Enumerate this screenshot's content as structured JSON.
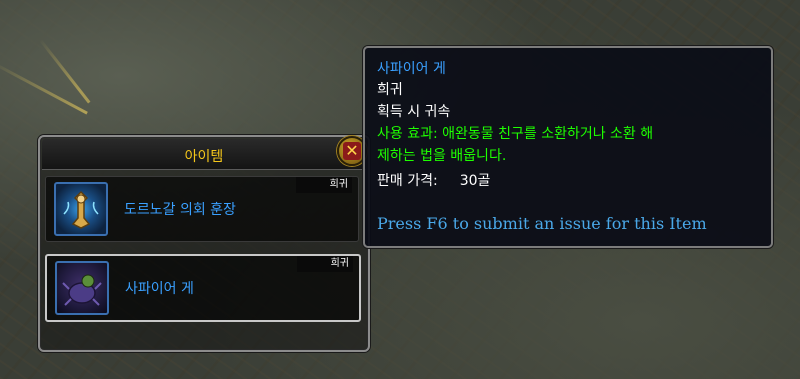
{
  "loot_window": {
    "title": "아이템",
    "items": [
      {
        "name": "도르노갈 의회 훈장",
        "rarity": "희귀",
        "icon": "charter-icon"
      },
      {
        "name": "사파이어 게",
        "rarity": "희귀",
        "icon": "crab-icon"
      }
    ]
  },
  "tooltip": {
    "item_name": "사파이어 게",
    "rarity": "희귀",
    "binding": "획득 시 귀속",
    "use_effect_line1": "사용 효과: 애완동물 친구를 소환하거나 소환 해",
    "use_effect_line2": "제하는 법을 배웁니다.",
    "sell_label": "판매 가격:",
    "sell_value": "30골",
    "report_hint": "Press F6 to submit an issue for this Item"
  },
  "colors": {
    "rare_blue": "#3aa0ff",
    "use_green": "#1eff00",
    "title_gold": "#f5c71a"
  }
}
